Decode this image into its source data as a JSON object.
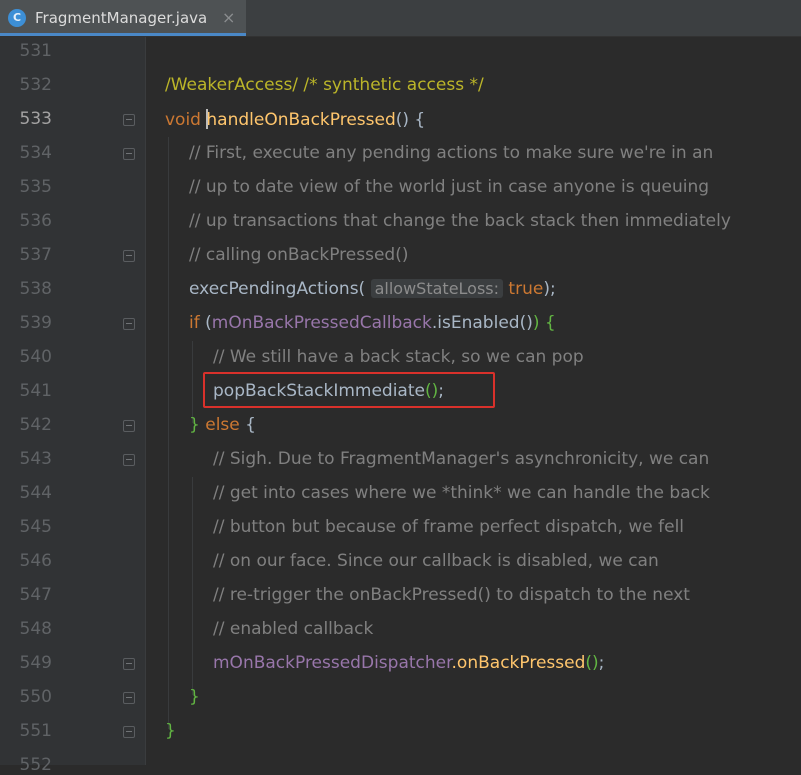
{
  "tab": {
    "icon_letter": "C",
    "filename": "FragmentManager.java",
    "close_glyph": "×"
  },
  "gutter": {
    "lines": [
      "531",
      "532",
      "533",
      "534",
      "535",
      "536",
      "537",
      "538",
      "539",
      "540",
      "541",
      "542",
      "543",
      "544",
      "545",
      "546",
      "547",
      "548",
      "549",
      "550",
      "551",
      "552"
    ],
    "current_line": "533"
  },
  "code": {
    "l532": "/WeakerAccess/ /* synthetic access */",
    "l533_kw": "void",
    "l533_fn": "handleOnBackPressed",
    "l533_rest": "() {",
    "l534": "// First, execute any pending actions to make sure we're in an",
    "l535": "// up to date view of the world just in case anyone is queuing",
    "l536": "// up transactions that change the back stack then immediately",
    "l537": "// calling onBackPressed()",
    "l538_call": "execPendingActions(",
    "l538_hint": "allowStateLoss:",
    "l538_val": "true",
    "l538_end": ");",
    "l539_kw": "if",
    "l539_open": " (",
    "l539_field": "mOnBackPressedCallback",
    "l539_rest": ".isEnabled()",
    "l539_close": ") {",
    "l540": "// We still have a back stack, so we can pop",
    "l541_call": "popBackStackImmediate",
    "l541_paren": "()",
    "l541_semi": ";",
    "l542_close": "} ",
    "l542_kw": "else",
    "l542_open": " {",
    "l543": "// Sigh. Due to FragmentManager's asynchronicity, we can",
    "l544": "// get into cases where we *think* we can handle the back",
    "l545": "// button but because of frame perfect dispatch, we fell",
    "l546": "// on our face. Since our callback is disabled, we can",
    "l547": "// re-trigger the onBackPressed() to dispatch to the next",
    "l548": "// enabled callback",
    "l549_field": "mOnBackPressedDispatcher",
    "l549_call": ".onBackPressed",
    "l549_paren": "()",
    "l549_semi": ";",
    "l550": "}",
    "l551": "}"
  },
  "colors": {
    "background": "#2b2b2b",
    "gutter": "#313335",
    "keyword": "#cc7832",
    "method": "#ffc66d",
    "field": "#9876aa",
    "comment": "#808080",
    "highlight_box": "#d9312b"
  }
}
